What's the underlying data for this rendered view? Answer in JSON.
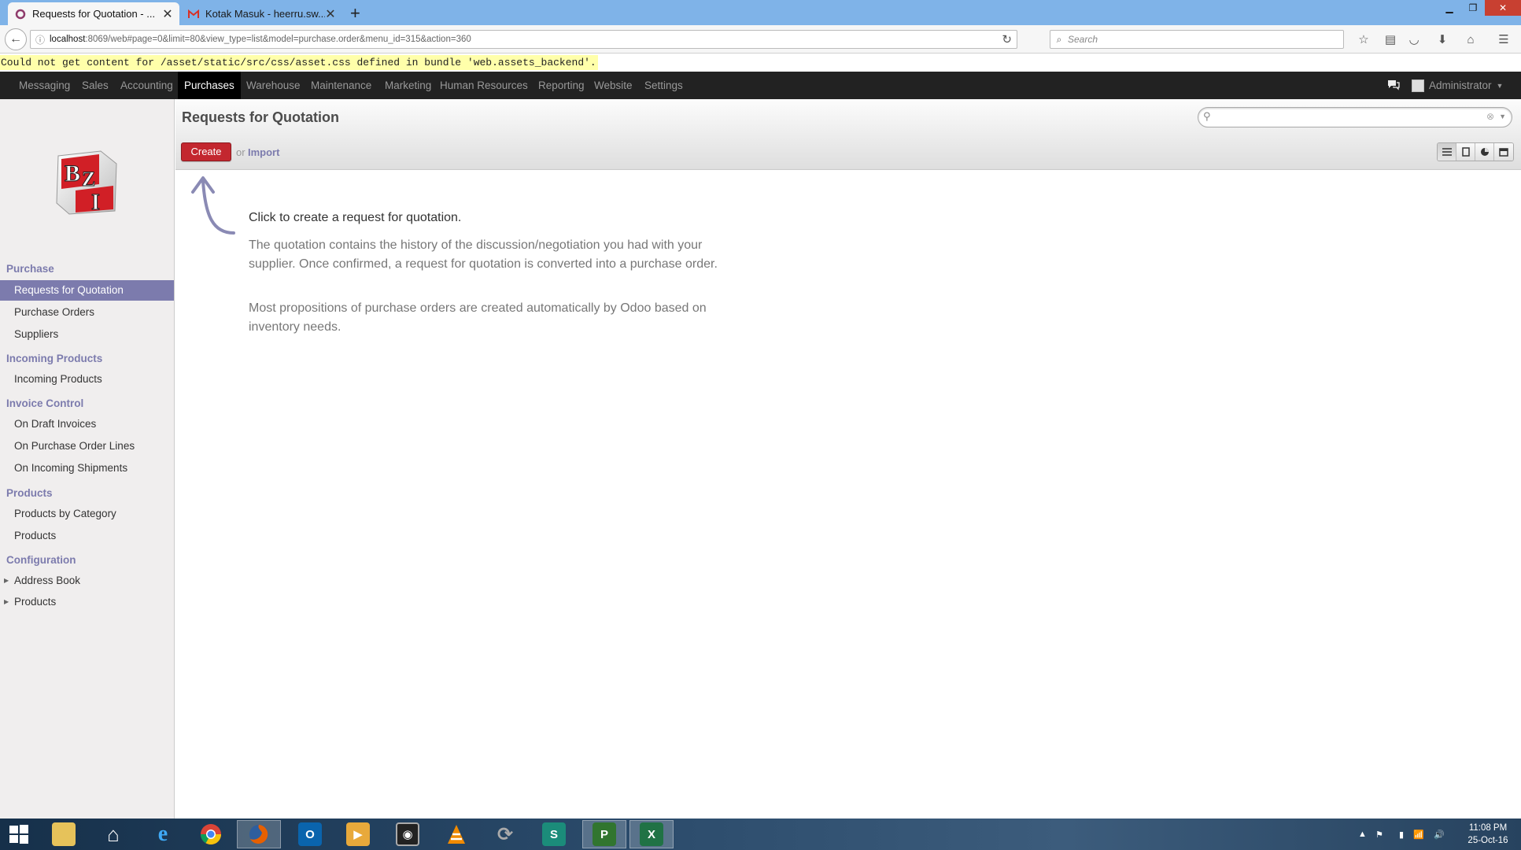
{
  "browser": {
    "tabs": [
      {
        "title": "Requests for Quotation - ...",
        "active": true
      },
      {
        "title": "Kotak Masuk - heerru.sw...",
        "active": false
      }
    ],
    "new_tab": "+",
    "url_host": "localhost",
    "url_rest": ":8069/web#page=0&limit=80&view_type=list&model=purchase.order&menu_id=315&action=360",
    "search_placeholder": "Search",
    "error": "Could not get content for /asset/static/src/css/asset.css defined in bundle 'web.assets_backend'."
  },
  "topmenu": {
    "items": [
      "Messaging",
      "Sales",
      "Accounting",
      "Purchases",
      "Warehouse",
      "Maintenance",
      "Marketing",
      "Human Resources",
      "Reporting",
      "Website",
      "Settings"
    ],
    "active": "Purchases",
    "user": "Administrator"
  },
  "sidebar": {
    "sections": [
      {
        "title": "Purchase",
        "items": [
          "Requests for Quotation",
          "Purchase Orders",
          "Suppliers"
        ]
      },
      {
        "title": "Incoming Products",
        "items": [
          "Incoming Products"
        ]
      },
      {
        "title": "Invoice Control",
        "items": [
          "On Draft Invoices",
          "On Purchase Order Lines",
          "On Incoming Shipments"
        ]
      },
      {
        "title": "Products",
        "items": [
          "Products by Category",
          "Products"
        ]
      },
      {
        "title": "Configuration",
        "items": [
          "Address Book",
          "Products"
        ]
      }
    ],
    "active_item": "Requests for Quotation"
  },
  "main": {
    "title": "Requests for Quotation",
    "create_label": "Create",
    "or_label": "or",
    "import_label": "Import",
    "help_title": "Click to create a request for quotation.",
    "help_p1": "The quotation contains the history of the discussion/negotiation you had with your supplier. Once confirmed, a request for quotation is converted into a purchase order.",
    "help_p2": "Most propositions of purchase orders are created automatically by Odoo based on inventory needs.",
    "views": [
      "list-view-icon",
      "form-view-icon",
      "graph-view-icon",
      "calendar-view-icon"
    ],
    "active_view": "list-view-icon"
  },
  "taskbar": {
    "time": "11:08 PM",
    "date": "25-Oct-16"
  },
  "colors": {
    "accent": "#7c7bad",
    "create": "#c3272f",
    "topbar": "#222222"
  }
}
